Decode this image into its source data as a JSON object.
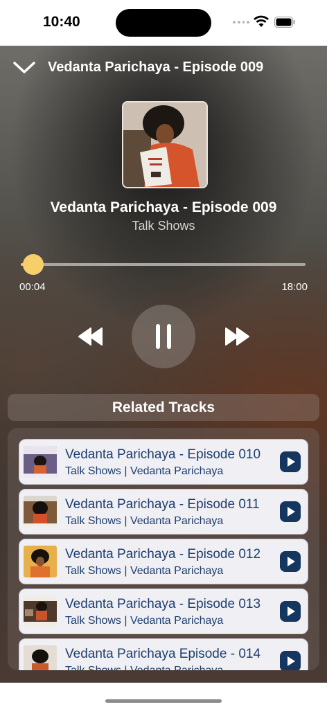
{
  "status_bar": {
    "time": "10:40",
    "icons": [
      "signal-icon",
      "wifi-icon",
      "battery-icon"
    ]
  },
  "header": {
    "title": "Vedanta Parichaya - Episode 009",
    "collapse_icon": "chevron-down-icon"
  },
  "now_playing": {
    "title": "Vedanta Parichaya - Episode 009",
    "subtitle": "Talk Shows",
    "elapsed": "00:04",
    "duration": "18:00",
    "progress_fraction": 0.004,
    "accent_color": "#f6cf6b"
  },
  "controls": {
    "rewind_icon": "rewind-icon",
    "pause_icon": "pause-icon",
    "forward_icon": "fast-forward-icon"
  },
  "related": {
    "heading": "Related Tracks",
    "tracks": [
      {
        "title": "Vedanta Parichaya - Episode 010",
        "subtitle": "Talk Shows | Vedanta Parichaya"
      },
      {
        "title": "Vedanta Parichaya - Episode 011",
        "subtitle": "Talk Shows | Vedanta Parichaya"
      },
      {
        "title": "Vedanta Parichaya - Episode 012",
        "subtitle": "Talk Shows | Vedanta Parichaya"
      },
      {
        "title": "Vedanta Parichaya - Episode 013",
        "subtitle": "Talk Shows | Vedanta Parichaya"
      },
      {
        "title": "Vedanta Parichaya Episode - 014",
        "subtitle": "Talk Shows | Vedanta Parichaya"
      }
    ],
    "play_icon": "play-icon",
    "play_color": "#14365f"
  }
}
